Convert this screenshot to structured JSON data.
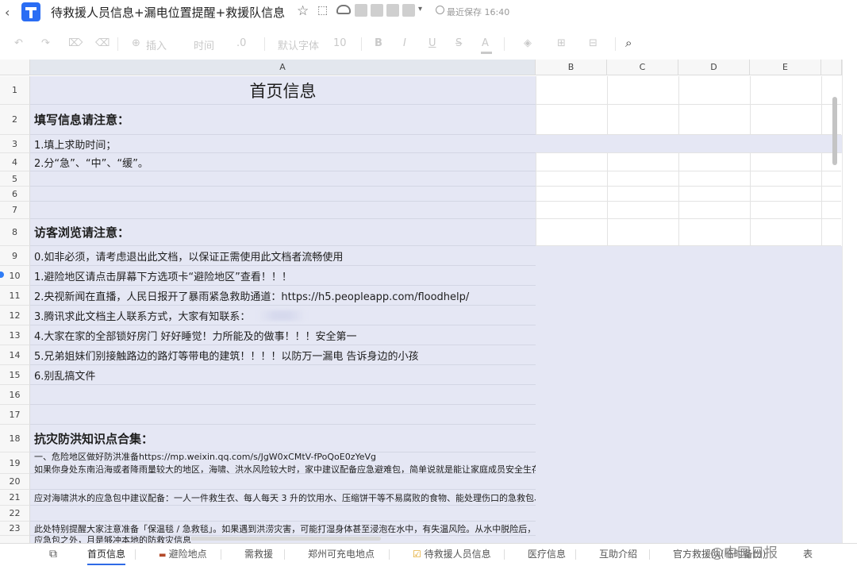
{
  "titlebar": {
    "back_icon": "chevron-left-icon",
    "doc_title": "待救援人员信息+漏电位置提醒+救援队信息",
    "save_status": "最近保存 16:40"
  },
  "toolbar": {
    "insert": "插入",
    "time": "时间",
    "decimal": ".0",
    "font_family": "默认字体",
    "font_size": "10",
    "bold": "B",
    "italic": "I",
    "underline": "U",
    "strike": "S",
    "font_color": "A"
  },
  "columns": [
    "A",
    "B",
    "C",
    "D",
    "E"
  ],
  "rows": [
    {
      "num": "1",
      "text": "首页信息",
      "style": "title"
    },
    {
      "num": "2",
      "text": "填写信息请注意：",
      "style": "heading"
    },
    {
      "num": "3",
      "text": "1.填上求助时间；",
      "style": "normal"
    },
    {
      "num": "4",
      "text": "2.分“急”、“中”、“缓”。",
      "style": "normal"
    },
    {
      "num": "5",
      "text": "",
      "style": "normal"
    },
    {
      "num": "6",
      "text": "",
      "style": "normal"
    },
    {
      "num": "7",
      "text": "",
      "style": "normal"
    },
    {
      "num": "8",
      "text": "访客浏览请注意：",
      "style": "heading"
    },
    {
      "num": "9",
      "text": "0.如非必须，请考虑退出此文档，以保证正需使用此文档者流畅使用",
      "style": "normal"
    },
    {
      "num": "10",
      "text": "1.避险地区请点击屏幕下方选项卡“避险地区”查看！！！",
      "style": "normal"
    },
    {
      "num": "11",
      "text": "2.央视新闻在直播，人民日报开了暴雨紧急救助通道：https://h5.peopleapp.com/floodhelp/",
      "style": "normal"
    },
    {
      "num": "12",
      "text": "3.腾讯求此文档主人联系方式，大家有知联系：",
      "style": "blurred"
    },
    {
      "num": "13",
      "text": "4.大家在家的全部锁好房门 好好睡觉！力所能及的做事！！！安全第一",
      "style": "normal"
    },
    {
      "num": "14",
      "text": "5.兄弟姐妹们别接触路边的路灯等带电的建筑！！！！以防万一漏电 告诉身边的小孩",
      "style": "normal"
    },
    {
      "num": "15",
      "text": "6.别乱搞文件",
      "style": "normal"
    },
    {
      "num": "16",
      "text": "",
      "style": "normal"
    },
    {
      "num": "17",
      "text": "",
      "style": "normal"
    },
    {
      "num": "18",
      "text": "抗灾防洪知识点合集：",
      "style": "heading"
    },
    {
      "num": "19",
      "text": "一、危险地区做好防洪准备https://mp.weixin.qq.com/s/JgW0xCMtV-fPoQoE0zYeVg",
      "text2": "如果你身处东南沿海或者降雨量较大的地区，海啸、洪水风险较大时，家中建议配备应急避难包，简单说就是能让家庭成员安全生存几天所需要的物质。",
      "style": "small2"
    },
    {
      "num": "20",
      "text": "",
      "style": "small"
    },
    {
      "num": "21",
      "text": "应对海啸洪水的应急包中建议配备：一人一件救生衣、每人每天 3 升的饮用水、压缩饼干等不易腐败的食物、能处理伤口的急救包、充电宝、湿巾等卫生用品、急救毯、现金、防水袋包裹的身份证复印件等。",
      "style": "small"
    },
    {
      "num": "22",
      "text": "",
      "style": "small"
    },
    {
      "num": "23",
      "text": "此处特别提醒大家注意准备「保温毯 / 急救毯」。如果遇到洪涝灾害，可能打湿身体甚至浸泡在水中，有失温风险。从水中脱险后，除了尽快去往安全区域外，同时也要尽快换掉打湿的衣物，让身体恢复干燥",
      "style": "small"
    },
    {
      "num": "",
      "text": "应急包之外，月是够冲本地的防救灾信息",
      "style": "small"
    }
  ],
  "tabs": [
    {
      "label": "首页信息",
      "active": true
    },
    {
      "label": "避险地点",
      "active": false
    },
    {
      "label": "需救援",
      "active": false
    },
    {
      "label": "郑州可充电地点",
      "active": false
    },
    {
      "label": "待救援人员信息",
      "active": false
    },
    {
      "label": "医疗信息",
      "active": false
    },
    {
      "label": "互助介绍",
      "active": false
    },
    {
      "label": "官方救援队(临时备份)",
      "active": false
    },
    {
      "label": "表",
      "active": false
    }
  ],
  "watermark": "@中国日报",
  "colors": {
    "accent": "#2f6ae6",
    "cell_tint": "#e5e7f4",
    "logo": "#2a6df4"
  }
}
